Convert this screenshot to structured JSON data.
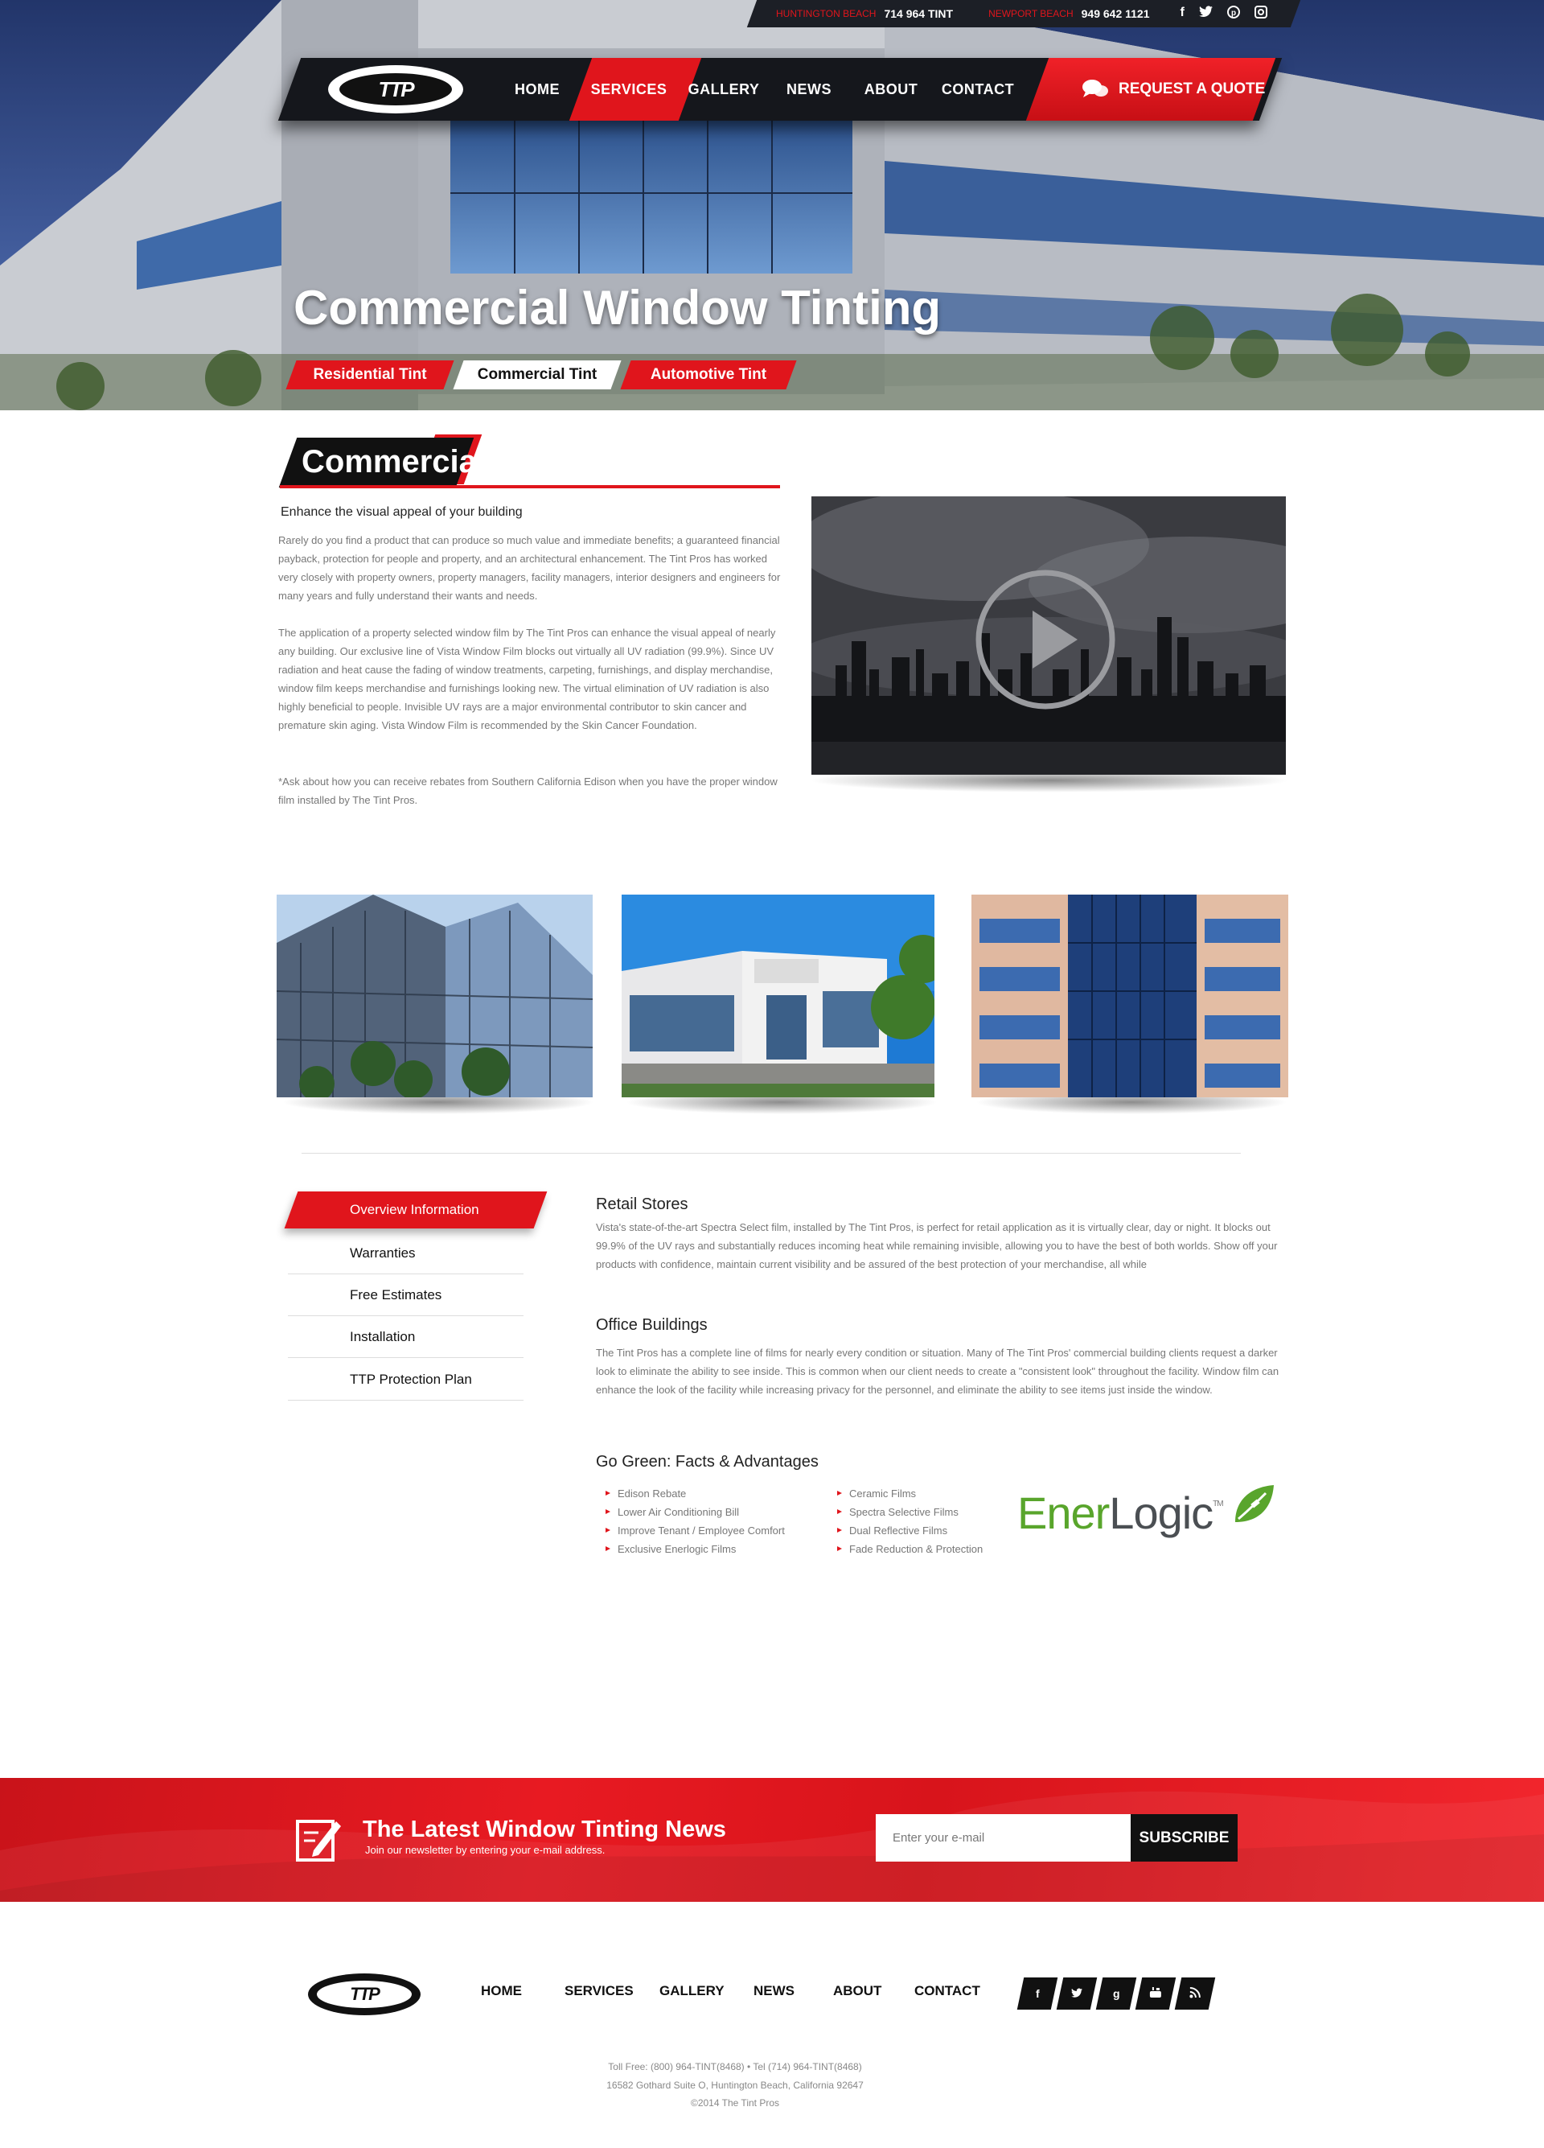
{
  "topbar": {
    "loc1": "HUNTINGTON BEACH",
    "phone1": "714 964 TINT",
    "loc2": "NEWPORT BEACH",
    "phone2": "949 642 1121",
    "social_icons": [
      "facebook-icon",
      "twitter-icon",
      "pinterest-icon",
      "instagram-icon"
    ]
  },
  "brand": {
    "logo_text": "TTP"
  },
  "nav": {
    "items": [
      "HOME",
      "SERVICES",
      "GALLERY",
      "NEWS",
      "ABOUT",
      "CONTACT"
    ],
    "active_index": 1,
    "quote": "REQUEST A QUOTE"
  },
  "hero": {
    "title": "Commercial Window Tinting",
    "tabs": [
      "Residential Tint",
      "Commercial Tint",
      "Automotive Tint"
    ],
    "active_tab": 1
  },
  "intro": {
    "heading": "Commercial",
    "subheading": "Enhance the visual appeal of your building",
    "p1": "Rarely do you find a product that can produce so much value and immediate benefits; a guaranteed financial payback, protection for people and property, and an architectural enhancement. The Tint Pros has worked very closely with property owners, property managers, facility managers, interior designers and engineers for many years and fully understand their wants and needs.",
    "p2": "The application of a property selected window film by The Tint Pros can enhance the visual appeal of nearly any building. Our exclusive line of Vista Window Film blocks out virtually all UV radiation (99.9%). Since UV radiation and heat cause the fading of window treatments, carpeting, furnishings, and display merchandise, window film keeps merchandise and furnishings looking new. The virtual elimination of UV radiation is also highly beneficial to people. Invisible UV rays are a major environmental contributor to skin cancer and premature skin aging. Vista Window Film is recommended by the Skin Cancer Foundation.",
    "p3": "*Ask about how you can receive rebates from Southern California Edison when you have the proper window film installed by The Tint Pros."
  },
  "sidebar": {
    "items": [
      "Overview Information",
      "Warranties",
      "Free Estimates",
      "Installation",
      "TTP Protection Plan"
    ],
    "active_index": 0
  },
  "content": {
    "retail_title": "Retail Stores",
    "retail_text": "Vista's state-of-the-art Spectra Select film, installed by The Tint Pros, is perfect for retail application as it is virtually clear, day or night. It blocks out 99.9% of the UV rays and substantially reduces incoming heat while remaining invisible, allowing you to have the best of both worlds. Show off your products with confidence, maintain current visibility and be assured of the best protection of your merchandise, all while",
    "office_title": "Office Buildings",
    "office_text": "The Tint Pros has a complete line of films for nearly every condition or situation. Many of The Tint Pros' commercial building clients request a darker look to eliminate the ability to see inside. This is common when our client needs to create a \"consistent look\" throughout the facility. Window film can enhance the look of the facility while increasing privacy for the personnel, and eliminate the ability to see items just inside the window.",
    "green_title": "Go Green: Facts & Advantages",
    "green_col1": [
      "Edison Rebate",
      "Lower Air Conditioning Bill",
      "Improve Tenant / Employee Comfort",
      "Exclusive Enerlogic Films"
    ],
    "green_col2": [
      "Ceramic Films",
      "Spectra Selective Films",
      "Dual Reflective Films",
      "Fade Reduction & Protection"
    ],
    "logo_ener": "Ener",
    "logo_logic": "Logic",
    "logo_tm": "TM"
  },
  "newsletter": {
    "title": "The Latest Window Tinting News",
    "subtitle": "Join our newsletter by entering your e-mail address.",
    "placeholder": "Enter your e-mail",
    "button": "SUBSCRIBE"
  },
  "footer": {
    "logo_text": "TTP",
    "nav": [
      "HOME",
      "SERVICES",
      "GALLERY",
      "NEWS",
      "ABOUT",
      "CONTACT"
    ],
    "social": [
      "f",
      "twitter-icon",
      "g",
      "youtube-icon",
      "rss-icon"
    ],
    "line1": "Toll Free: (800) 964-TINT(8468) • Tel (714) 964-TINT(8468)",
    "line2": "16582 Gothard Suite O, Huntington Beach, California 92647",
    "line3": "©2014 The Tint Pros"
  },
  "colors": {
    "accent": "#e0151c",
    "dark": "#15171c",
    "green": "#59a52c"
  }
}
